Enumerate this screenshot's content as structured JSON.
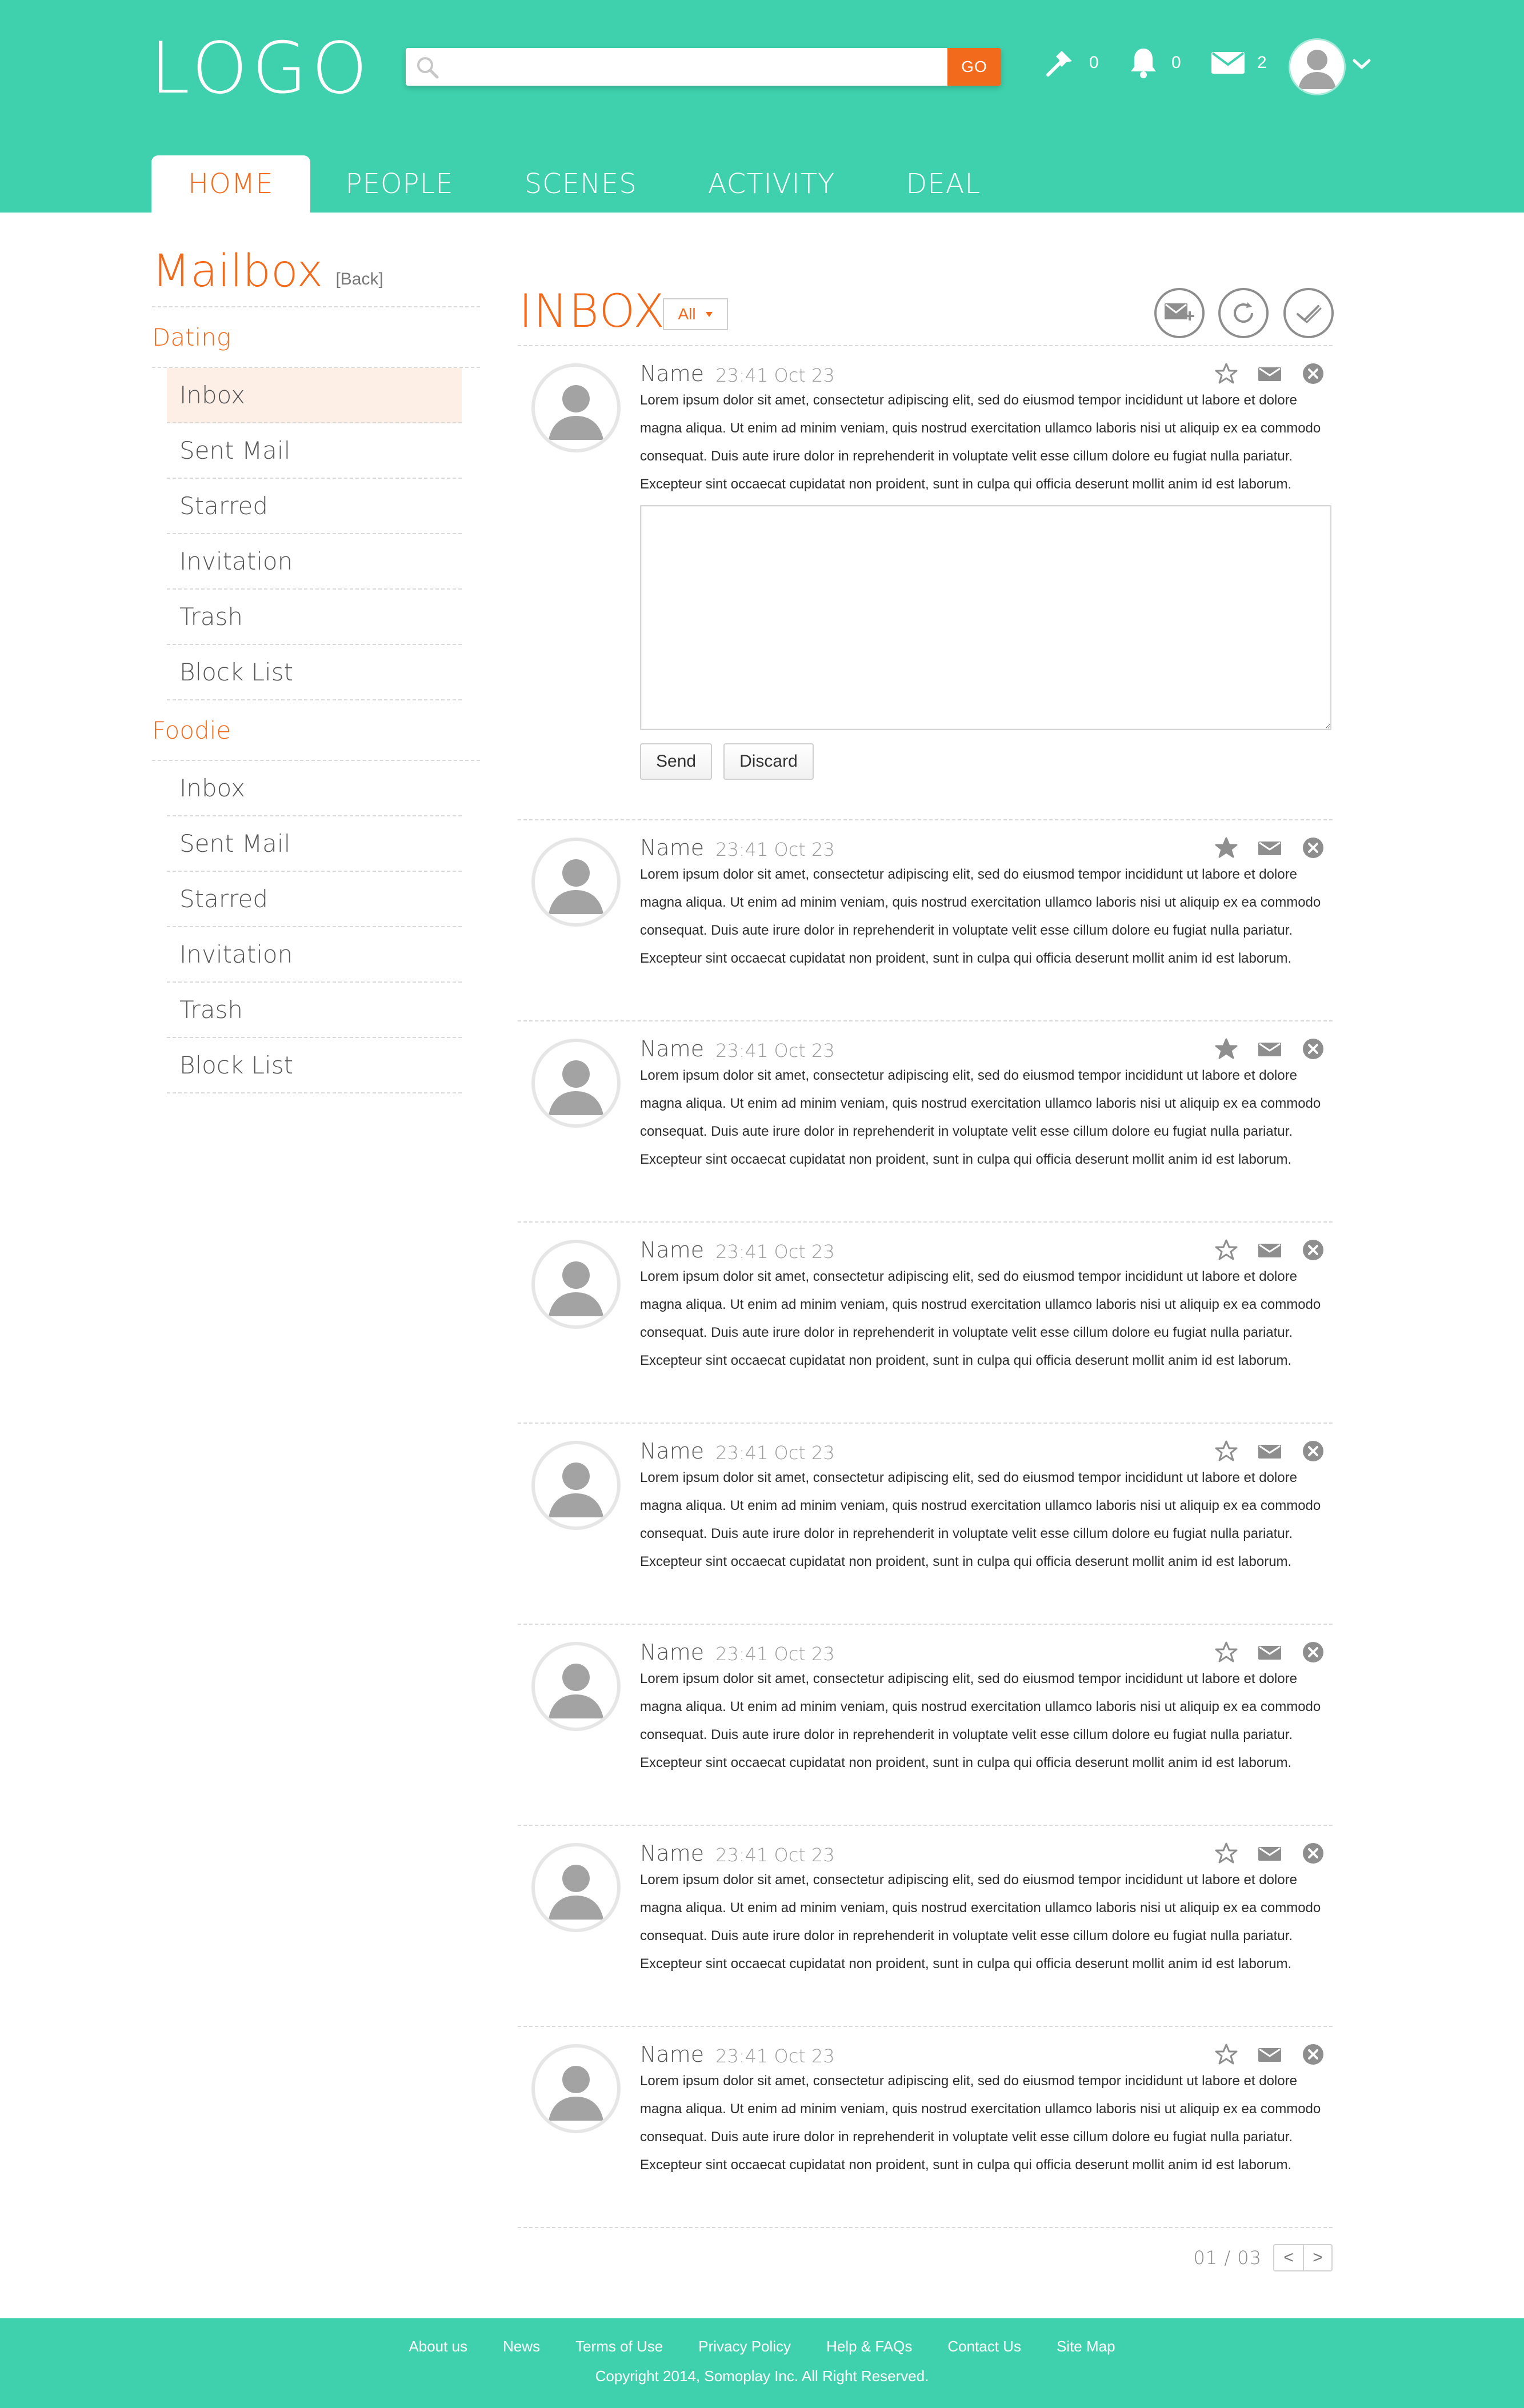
{
  "header": {
    "logo": "LOGO",
    "search": {
      "placeholder": "",
      "go": "GO"
    },
    "counts": {
      "pins": "0",
      "notifications": "0",
      "messages": "2"
    }
  },
  "nav": {
    "tabs": [
      "HOME",
      "PEOPLE",
      "SCENES",
      "ACTIVITY",
      "DEAL"
    ],
    "active": "HOME"
  },
  "sidebar": {
    "title": "Mailbox",
    "back": "[Back]",
    "sections": [
      {
        "name": "Dating",
        "items": [
          "Inbox",
          "Sent Mail",
          "Starred",
          "Invitation",
          "Trash",
          "Block List"
        ]
      },
      {
        "name": "Foodie",
        "items": [
          "Inbox",
          "Sent Mail",
          "Starred",
          "Invitation",
          "Trash",
          "Block List"
        ]
      }
    ],
    "selected": {
      "section": "Dating",
      "item": "Inbox"
    }
  },
  "main": {
    "title": "INBOX",
    "filter": "All",
    "messages": [
      {
        "name": "Name",
        "time": "23:41",
        "date": "Oct 23",
        "starred": false,
        "expanded": true,
        "body": "Lorem ipsum dolor sit amet, consectetur adipiscing elit, sed do eiusmod tempor incididunt ut labore et dolore magna aliqua. Ut enim ad minim veniam, quis nostrud exercitation ullamco laboris nisi ut aliquip ex ea commodo consequat. Duis aute irure dolor in reprehenderit in voluptate velit esse cillum dolore eu fugiat nulla pariatur. Excepteur sint occaecat cupidatat non proident, sunt in culpa qui officia deserunt mollit anim id est laborum."
      },
      {
        "name": "Name",
        "time": "23:41",
        "date": "Oct 23",
        "starred": true,
        "expanded": false,
        "body": "Lorem ipsum dolor sit amet, consectetur adipiscing elit, sed do eiusmod tempor incididunt ut labore et dolore magna aliqua. Ut enim ad minim veniam, quis nostrud exercitation ullamco laboris nisi ut aliquip ex ea commodo consequat. Duis aute irure dolor in reprehenderit in voluptate velit esse cillum dolore eu fugiat nulla pariatur. Excepteur sint occaecat cupidatat non proident, sunt in culpa qui officia deserunt mollit anim id est laborum."
      },
      {
        "name": "Name",
        "time": "23:41",
        "date": "Oct 23",
        "starred": true,
        "expanded": false,
        "body": "Lorem ipsum dolor sit amet, consectetur adipiscing elit, sed do eiusmod tempor incididunt ut labore et dolore magna aliqua. Ut enim ad minim veniam, quis nostrud exercitation ullamco laboris nisi ut aliquip ex ea commodo consequat. Duis aute irure dolor in reprehenderit in voluptate velit esse cillum dolore eu fugiat nulla pariatur. Excepteur sint occaecat cupidatat non proident, sunt in culpa qui officia deserunt mollit anim id est laborum."
      },
      {
        "name": "Name",
        "time": "23:41",
        "date": "Oct 23",
        "starred": false,
        "expanded": false,
        "body": "Lorem ipsum dolor sit amet, consectetur adipiscing elit, sed do eiusmod tempor incididunt ut labore et dolore magna aliqua. Ut enim ad minim veniam, quis nostrud exercitation ullamco laboris nisi ut aliquip ex ea commodo consequat. Duis aute irure dolor in reprehenderit in voluptate velit esse cillum dolore eu fugiat nulla pariatur. Excepteur sint occaecat cupidatat non proident, sunt in culpa qui officia deserunt mollit anim id est laborum."
      },
      {
        "name": "Name",
        "time": "23:41",
        "date": "Oct 23",
        "starred": false,
        "expanded": false,
        "body": "Lorem ipsum dolor sit amet, consectetur adipiscing elit, sed do eiusmod tempor incididunt ut labore et dolore magna aliqua. Ut enim ad minim veniam, quis nostrud exercitation ullamco laboris nisi ut aliquip ex ea commodo consequat. Duis aute irure dolor in reprehenderit in voluptate velit esse cillum dolore eu fugiat nulla pariatur. Excepteur sint occaecat cupidatat non proident, sunt in culpa qui officia deserunt mollit anim id est laborum."
      },
      {
        "name": "Name",
        "time": "23:41",
        "date": "Oct 23",
        "starred": false,
        "expanded": false,
        "body": "Lorem ipsum dolor sit amet, consectetur adipiscing elit, sed do eiusmod tempor incididunt ut labore et dolore magna aliqua. Ut enim ad minim veniam, quis nostrud exercitation ullamco laboris nisi ut aliquip ex ea commodo consequat. Duis aute irure dolor in reprehenderit in voluptate velit esse cillum dolore eu fugiat nulla pariatur. Excepteur sint occaecat cupidatat non proident, sunt in culpa qui officia deserunt mollit anim id est laborum."
      },
      {
        "name": "Name",
        "time": "23:41",
        "date": "Oct 23",
        "starred": false,
        "expanded": false,
        "body": "Lorem ipsum dolor sit amet, consectetur adipiscing elit, sed do eiusmod tempor incididunt ut labore et dolore magna aliqua. Ut enim ad minim veniam, quis nostrud exercitation ullamco laboris nisi ut aliquip ex ea commodo consequat. Duis aute irure dolor in reprehenderit in voluptate velit esse cillum dolore eu fugiat nulla pariatur. Excepteur sint occaecat cupidatat non proident, sunt in culpa qui officia deserunt mollit anim id est laborum."
      },
      {
        "name": "Name",
        "time": "23:41",
        "date": "Oct 23",
        "starred": false,
        "expanded": false,
        "body": "Lorem ipsum dolor sit amet, consectetur adipiscing elit, sed do eiusmod tempor incididunt ut labore et dolore magna aliqua. Ut enim ad minim veniam, quis nostrud exercitation ullamco laboris nisi ut aliquip ex ea commodo consequat. Duis aute irure dolor in reprehenderit in voluptate velit esse cillum dolore eu fugiat nulla pariatur. Excepteur sint occaecat cupidatat non proident, sunt in culpa qui officia deserunt mollit anim id est laborum."
      }
    ],
    "reply": {
      "send": "Send",
      "discard": "Discard"
    },
    "pagination": {
      "label": "01 / 03",
      "prev": "<",
      "next": ">"
    }
  },
  "footer": {
    "links": [
      "About us",
      "News",
      "Terms of Use",
      "Privacy Policy",
      "Help & FAQs",
      "Contact Us",
      "Site Map"
    ],
    "copyright": "Copyright 2014, Somoplay Inc. All Right Reserved."
  },
  "colors": {
    "teal": "#3fd1ad",
    "orange": "#f26a1b"
  },
  "icons": [
    "search-icon",
    "pin-icon",
    "bell-icon",
    "mail-icon",
    "chevron-down-icon",
    "compose-icon",
    "refresh-icon",
    "mark-read-icon",
    "star-icon",
    "reply-icon",
    "delete-icon",
    "avatar-icon"
  ]
}
